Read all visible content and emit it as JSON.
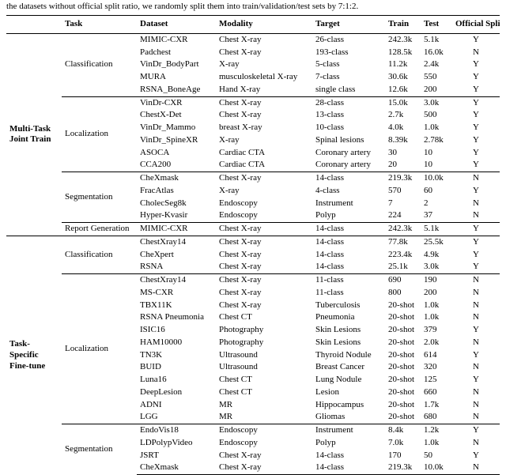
{
  "caption": "the datasets without official split ratio, we randomly split them into train/validation/test sets by 7:1:2.",
  "headers": {
    "stage": "",
    "task": "Task",
    "dataset": "Dataset",
    "modality": "Modality",
    "target": "Target",
    "train": "Train",
    "test": "Test",
    "split": "Official Split"
  },
  "stages": [
    {
      "name": "Multi-Task Joint Train",
      "tasks": [
        {
          "name": "Classification",
          "rows": [
            {
              "dataset": "MIMIC-CXR",
              "modality": "Chest X-ray",
              "target": "26-class",
              "train": "242.3k",
              "test": "5.1k",
              "split": "Y"
            },
            {
              "dataset": "Padchest",
              "modality": "Chest X-ray",
              "target": "193-class",
              "train": "128.5k",
              "test": "16.0k",
              "split": "N"
            },
            {
              "dataset": "VinDr_BodyPart",
              "modality": "X-ray",
              "target": "5-class",
              "train": "11.2k",
              "test": "2.4k",
              "split": "Y"
            },
            {
              "dataset": "MURA",
              "modality": "musculoskeletal X-ray",
              "target": "7-class",
              "train": "30.6k",
              "test": "550",
              "split": "Y"
            },
            {
              "dataset": "RSNA_BoneAge",
              "modality": "Hand X-ray",
              "target": "single class",
              "train": "12.6k",
              "test": "200",
              "split": "Y"
            }
          ]
        },
        {
          "name": "Localization",
          "rows": [
            {
              "dataset": "VinDr-CXR",
              "modality": "Chest X-ray",
              "target": "28-class",
              "train": "15.0k",
              "test": "3.0k",
              "split": "Y"
            },
            {
              "dataset": "ChestX-Det",
              "modality": "Chest X-ray",
              "target": "13-class",
              "train": "2.7k",
              "test": "500",
              "split": "Y"
            },
            {
              "dataset": "VinDr_Mammo",
              "modality": "breast X-ray",
              "target": "10-class",
              "train": "4.0k",
              "test": "1.0k",
              "split": "Y"
            },
            {
              "dataset": "VinDr_SpineXR",
              "modality": "X-ray",
              "target": "Spinal lesions",
              "train": "8.39k",
              "test": "2.78k",
              "split": "Y"
            },
            {
              "dataset": "ASOCA",
              "modality": "Cardiac CTA",
              "target": "Coronary artery",
              "train": "30",
              "test": "10",
              "split": "Y"
            },
            {
              "dataset": "CCA200",
              "modality": "Cardiac CTA",
              "target": "Coronary artery",
              "train": "20",
              "test": "10",
              "split": "Y"
            }
          ]
        },
        {
          "name": "Segmentation",
          "rows": [
            {
              "dataset": "CheXmask",
              "modality": "Chest X-ray",
              "target": "14-class",
              "train": "219.3k",
              "test": "10.0k",
              "split": "N"
            },
            {
              "dataset": "FracAtlas",
              "modality": "X-ray",
              "target": "4-class",
              "train": "570",
              "test": "60",
              "split": "Y"
            },
            {
              "dataset": "CholecSeg8k",
              "modality": "Endoscopy",
              "target": "Instrument",
              "train": "7",
              "test": "2",
              "split": "N"
            },
            {
              "dataset": "Hyper-Kvasir",
              "modality": "Endoscopy",
              "target": "Polyp",
              "train": "224",
              "test": "37",
              "split": "N"
            }
          ]
        },
        {
          "name": "Report Generation",
          "rows": [
            {
              "dataset": "MIMIC-CXR",
              "modality": "Chest X-ray",
              "target": "14-class",
              "train": "242.3k",
              "test": "5.1k",
              "split": "Y"
            }
          ]
        }
      ]
    },
    {
      "name": "Task-Specific Fine-tune",
      "tasks": [
        {
          "name": "Classification",
          "rows": [
            {
              "dataset": "ChestXray14",
              "modality": "Chest X-ray",
              "target": "14-class",
              "train": "77.8k",
              "test": "25.5k",
              "split": "Y"
            },
            {
              "dataset": "CheXpert",
              "modality": "Chest X-ray",
              "target": "14-class",
              "train": "223.4k",
              "test": "4.9k",
              "split": "Y"
            },
            {
              "dataset": "RSNA",
              "modality": "Chest X-ray",
              "target": "14-class",
              "train": "25.1k",
              "test": "3.0k",
              "split": "Y"
            }
          ]
        },
        {
          "name": "Localization",
          "rows": [
            {
              "dataset": "ChestXray14",
              "modality": "Chest X-ray",
              "target": "11-class",
              "train": "690",
              "test": "190",
              "split": "N"
            },
            {
              "dataset": "MS-CXR",
              "modality": "Chest X-ray",
              "target": "11-class",
              "train": "800",
              "test": "200",
              "split": "N"
            },
            {
              "dataset": "TBX11K",
              "modality": "Chest X-ray",
              "target": "Tuberculosis",
              "train": "20-shot",
              "test": "1.0k",
              "split": "N"
            },
            {
              "dataset": "RSNA Pneumonia",
              "modality": "Chest CT",
              "target": "Pneumonia",
              "train": "20-shot",
              "test": "1.0k",
              "split": "N"
            },
            {
              "dataset": "ISIC16",
              "modality": "Photography",
              "target": "Skin Lesions",
              "train": "20-shot",
              "test": "379",
              "split": "Y"
            },
            {
              "dataset": "HAM10000",
              "modality": "Photography",
              "target": "Skin Lesions",
              "train": "20-shot",
              "test": "2.0k",
              "split": "N"
            },
            {
              "dataset": "TN3K",
              "modality": "Ultrasound",
              "target": "Thyroid Nodule",
              "train": "20-shot",
              "test": "614",
              "split": "Y"
            },
            {
              "dataset": "BUID",
              "modality": "Ultrasound",
              "target": "Breast Cancer",
              "train": "20-shot",
              "test": "320",
              "split": "N"
            },
            {
              "dataset": "Luna16",
              "modality": "Chest CT",
              "target": "Lung Nodule",
              "train": "20-shot",
              "test": "125",
              "split": "Y"
            },
            {
              "dataset": "DeepLesion",
              "modality": "Chest CT",
              "target": "Lesion",
              "train": "20-shot",
              "test": "660",
              "split": "N"
            },
            {
              "dataset": "ADNI",
              "modality": "MR",
              "target": "Hippocampus",
              "train": "20-shot",
              "test": "1.7k",
              "split": "N"
            },
            {
              "dataset": "LGG",
              "modality": "MR",
              "target": "Gliomas",
              "train": "20-shot",
              "test": "680",
              "split": "N"
            }
          ]
        },
        {
          "name": "Segmentation",
          "rows": [
            {
              "dataset": "EndoVis18",
              "modality": "Endoscopy",
              "target": "Instrument",
              "train": "8.4k",
              "test": "1.2k",
              "split": "Y"
            },
            {
              "dataset": "LDPolypVideo",
              "modality": "Endoscopy",
              "target": "Polyp",
              "train": "7.0k",
              "test": "1.0k",
              "split": "N"
            },
            {
              "dataset": "JSRT",
              "modality": "Chest X-ray",
              "target": "14-class",
              "train": "170",
              "test": "50",
              "split": "Y"
            },
            {
              "dataset": "CheXmask",
              "modality": "Chest X-ray",
              "target": "14-class",
              "train": "219.3k",
              "test": "10.0k",
              "split": "N"
            }
          ]
        }
      ]
    }
  ]
}
